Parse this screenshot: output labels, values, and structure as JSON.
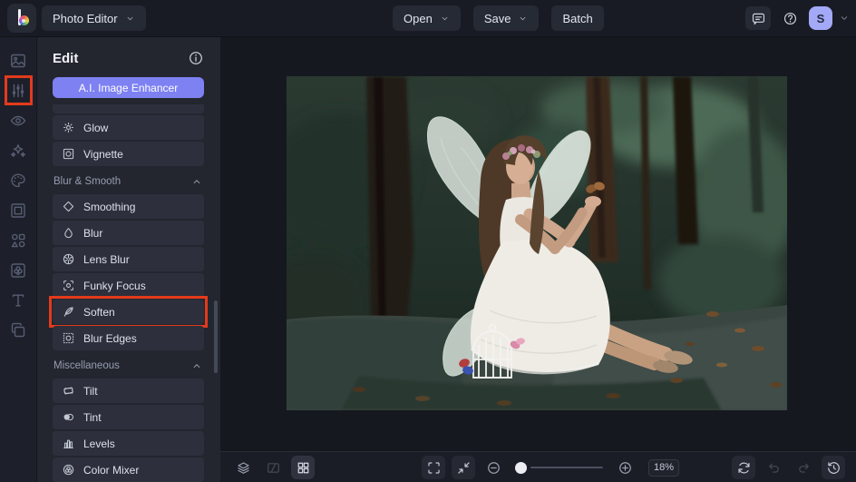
{
  "topbar": {
    "app_menu_label": "Photo Editor",
    "open_label": "Open",
    "save_label": "Save",
    "batch_label": "Batch",
    "avatar_initial": "S"
  },
  "rail": {
    "items": [
      {
        "id": "image-manager",
        "icon": "photo-icon"
      },
      {
        "id": "edit",
        "icon": "sliders-icon",
        "highlighted": true
      },
      {
        "id": "touch-up",
        "icon": "eye-icon"
      },
      {
        "id": "effects",
        "icon": "sparkles-icon"
      },
      {
        "id": "artsy",
        "icon": "palette-icon"
      },
      {
        "id": "frames",
        "icon": "frame-icon"
      },
      {
        "id": "graphics",
        "icon": "shapes-icon"
      },
      {
        "id": "overlays",
        "icon": "overlay-icon"
      },
      {
        "id": "text",
        "icon": "text-icon"
      },
      {
        "id": "layers",
        "icon": "layers-icon"
      }
    ]
  },
  "panel": {
    "title": "Edit",
    "ai_button_label": "A.I. Image Enhancer",
    "groups": [
      {
        "header": null,
        "items": [
          {
            "id": "glow",
            "icon": "glow-icon",
            "label": "Glow"
          },
          {
            "id": "vignette",
            "icon": "vignette-icon",
            "label": "Vignette"
          }
        ]
      },
      {
        "header": "Blur & Smooth",
        "items": [
          {
            "id": "smoothing",
            "icon": "smoothing-icon",
            "label": "Smoothing"
          },
          {
            "id": "blur",
            "icon": "blur-icon",
            "label": "Blur"
          },
          {
            "id": "lens-blur",
            "icon": "lens-blur-icon",
            "label": "Lens Blur"
          },
          {
            "id": "funky-focus",
            "icon": "funky-focus-icon",
            "label": "Funky Focus"
          },
          {
            "id": "soften",
            "icon": "soften-icon",
            "label": "Soften",
            "highlighted": true
          },
          {
            "id": "blur-edges",
            "icon": "blur-edges-icon",
            "label": "Blur Edges"
          }
        ]
      },
      {
        "header": "Miscellaneous",
        "items": [
          {
            "id": "tilt",
            "icon": "tilt-icon",
            "label": "Tilt"
          },
          {
            "id": "tint",
            "icon": "tint-icon",
            "label": "Tint"
          },
          {
            "id": "levels",
            "icon": "levels-icon",
            "label": "Levels"
          },
          {
            "id": "color-mixer",
            "icon": "color-mixer-icon",
            "label": "Color Mixer"
          }
        ]
      }
    ]
  },
  "canvas": {
    "image_alt": "Young woman in a white dress with fairy wings and a flower crown sitting against a tree in a forest, holding a butterfly, with a white birdcage beside her"
  },
  "bottombar": {
    "zoom_value": "18%"
  },
  "colors": {
    "accent": "#7d81f2",
    "annotation_red": "#e43a1c",
    "avatar_bg": "#a3a9f7"
  }
}
